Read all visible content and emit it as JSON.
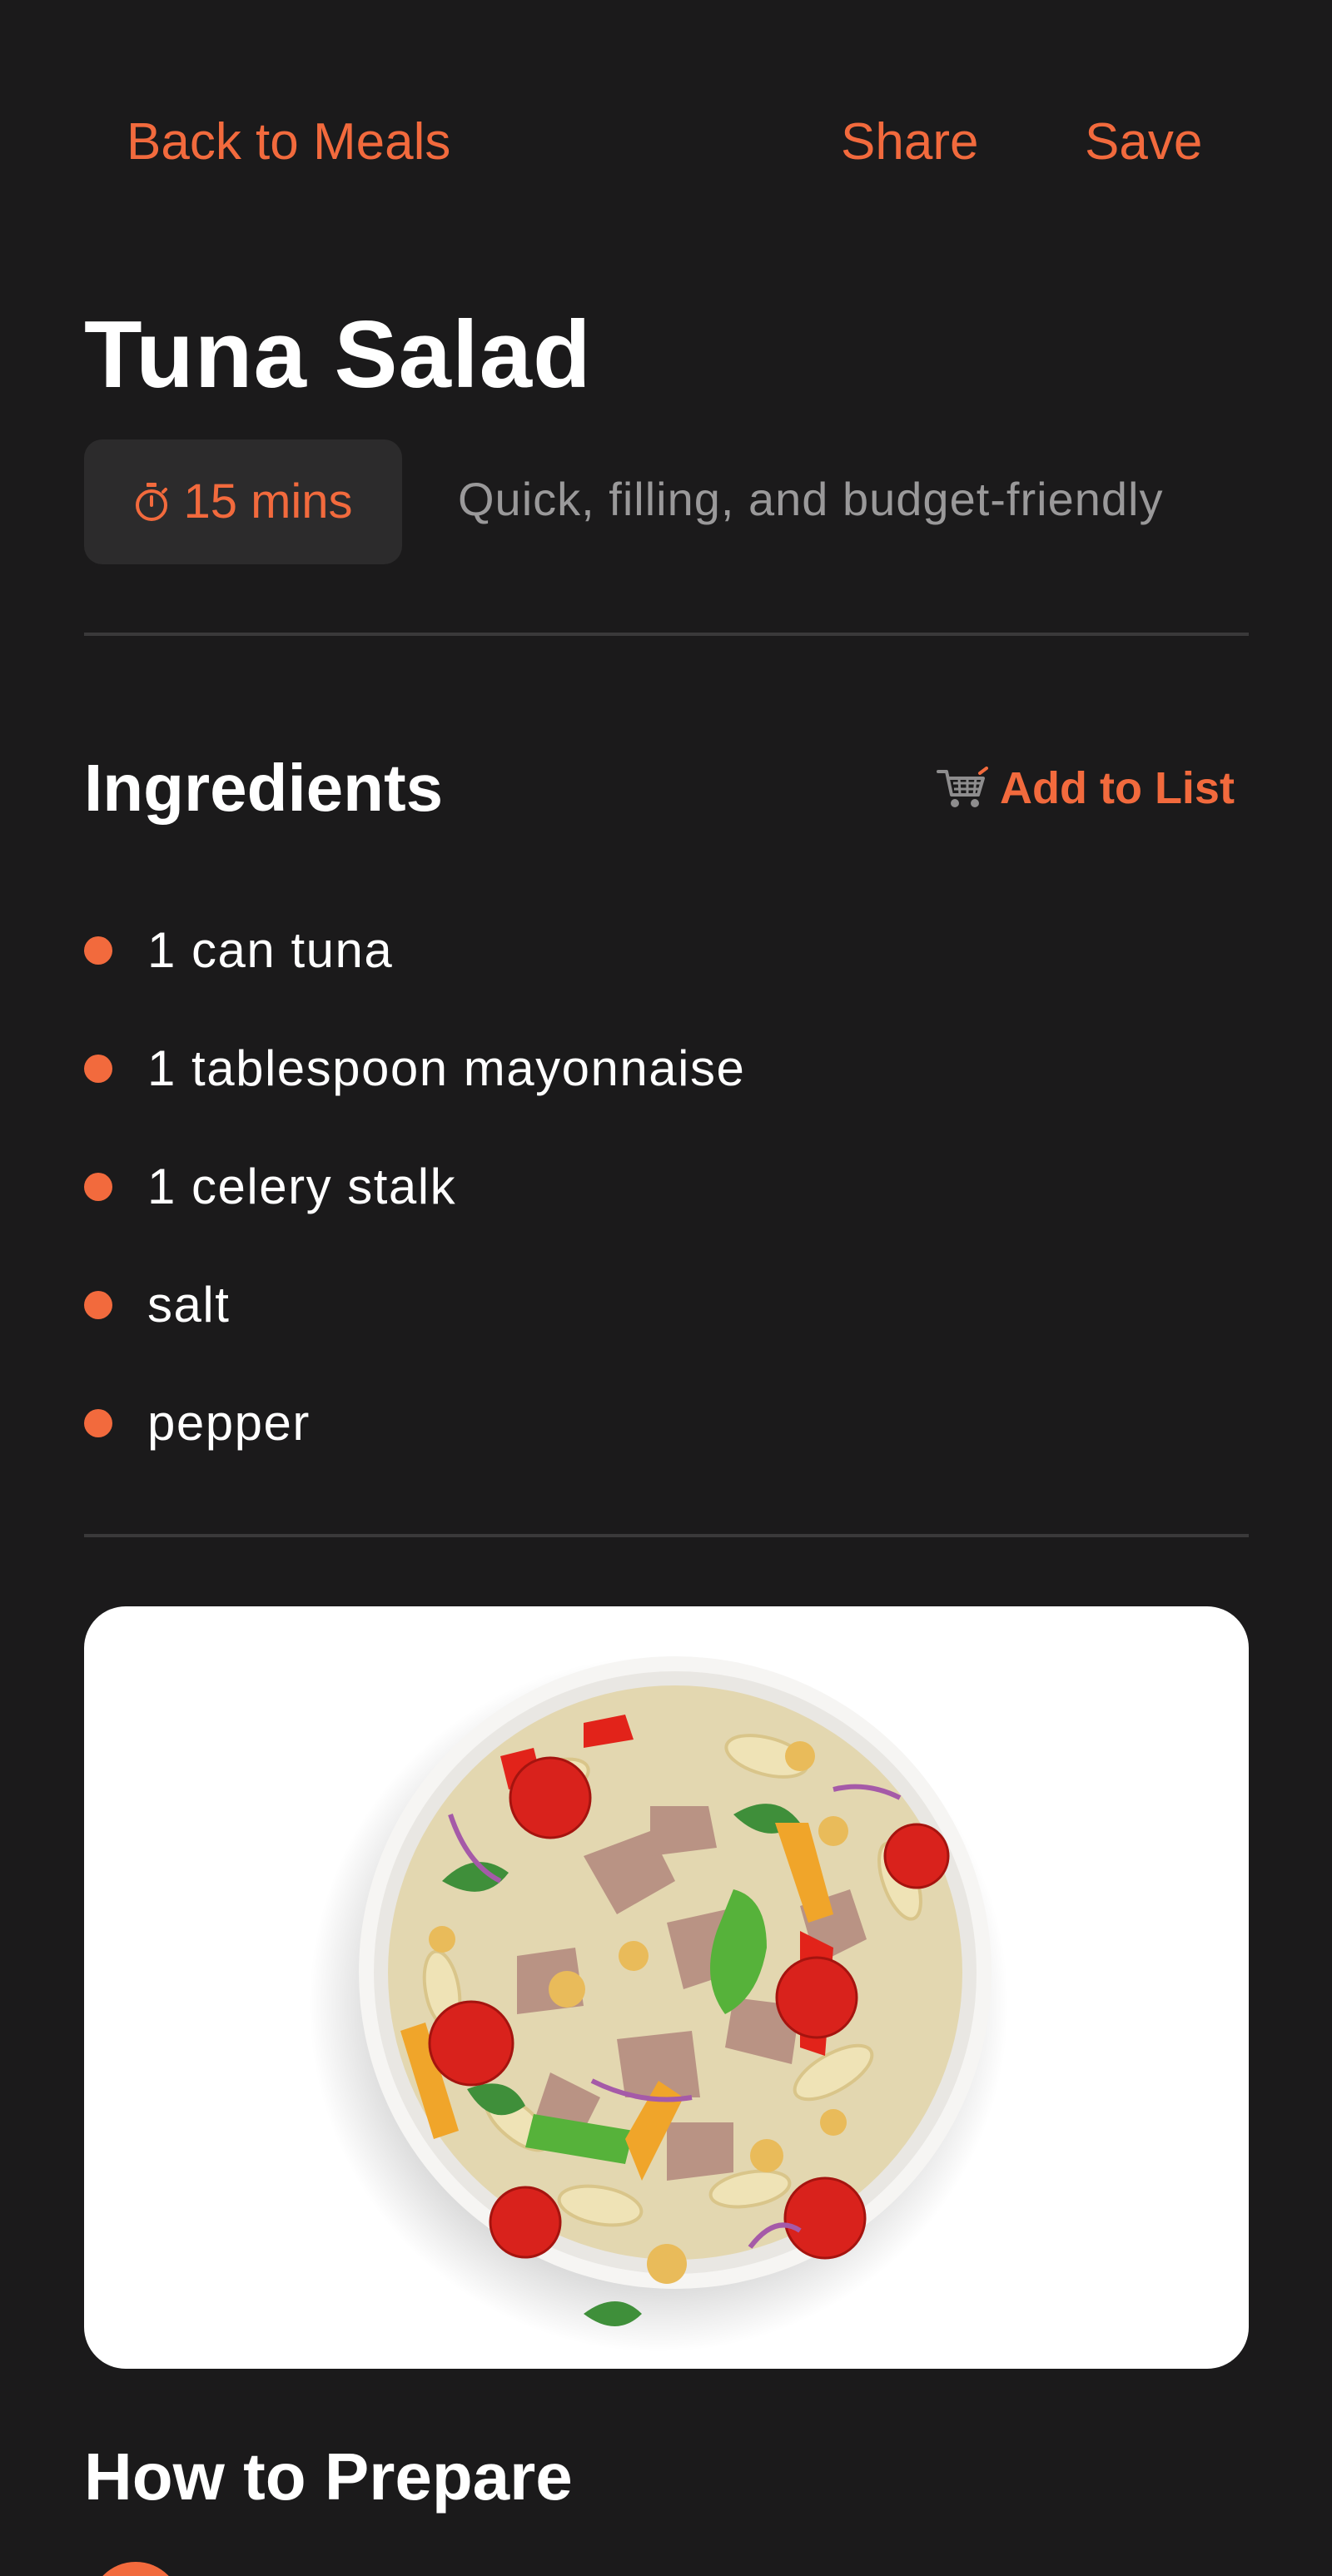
{
  "nav": {
    "back_label": "Back to Meals",
    "share_label": "Share",
    "save_label": "Save"
  },
  "meal": {
    "title": "Tuna Salad",
    "time": "15 mins",
    "time_icon": "stopwatch-icon",
    "tagline": "Quick, filling, and budget-friendly"
  },
  "ingredients": {
    "heading": "Ingredients",
    "add_to_list_label": "Add to List",
    "add_to_list_icon": "cart-icon",
    "items": [
      "1 can tuna",
      "1 tablespoon mayonnaise",
      "1 celery stalk",
      "salt",
      "pepper"
    ]
  },
  "prepare": {
    "heading": "How to Prepare"
  },
  "colors": {
    "background": "#1b1a1b",
    "accent": "#f26a3d",
    "chip_background": "#2c2b2c",
    "muted_text": "#9a999a",
    "divider": "#3a393a"
  }
}
